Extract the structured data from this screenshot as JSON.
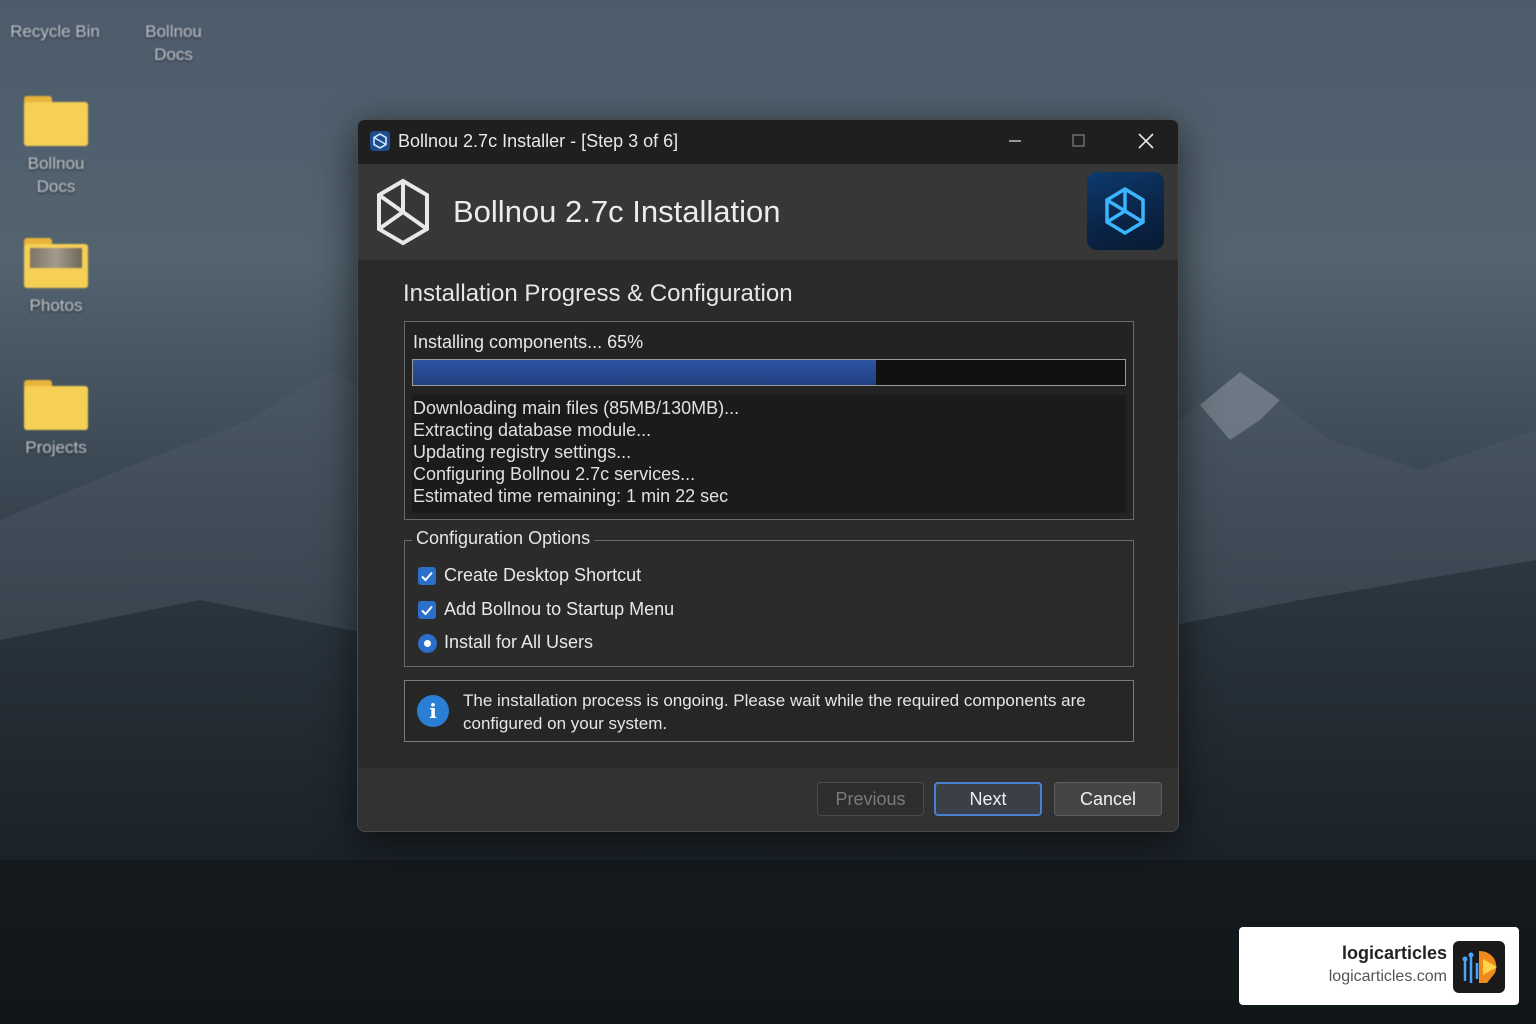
{
  "desktop": {
    "icons": [
      {
        "label": "Recycle Bin"
      },
      {
        "label": "Bollnou Docs"
      },
      {
        "label": "Bollnou Docs"
      },
      {
        "label": "Photos"
      },
      {
        "label": "Projects"
      }
    ]
  },
  "window": {
    "title": "Bollnou 2.7c Installer - [Step 3 of 6]",
    "header_title": "Bollnou 2.7c Installation",
    "section_title": "Installation Progress & Configuration",
    "progress": {
      "label": "Installing components... 65%",
      "percent": 65
    },
    "log_lines": [
      "Downloading main files (85MB/130MB)...",
      "Extracting database module...",
      "Updating registry settings...",
      "Configuring Bollnou 2.7c services...",
      "Estimated time remaining: 1 min 22 sec"
    ],
    "config": {
      "legend": "Configuration Options",
      "options": [
        {
          "label": "Create Desktop Shortcut",
          "type": "checkbox",
          "checked": true
        },
        {
          "label": "Add Bollnou to Startup Menu",
          "type": "checkbox",
          "checked": true
        },
        {
          "label": "Install for All Users",
          "type": "radio",
          "checked": true
        }
      ]
    },
    "info_text": "The installation process is ongoing. Please wait while the required components are configured on your system.",
    "buttons": {
      "previous": "Previous",
      "next": "Next",
      "cancel": "Cancel"
    },
    "colors": {
      "accent": "#2a6fc9",
      "progress": "#2d55a3",
      "info": "#2a7fd4"
    }
  },
  "watermark": {
    "name": "logicarticles",
    "url": "logicarticles.com"
  }
}
